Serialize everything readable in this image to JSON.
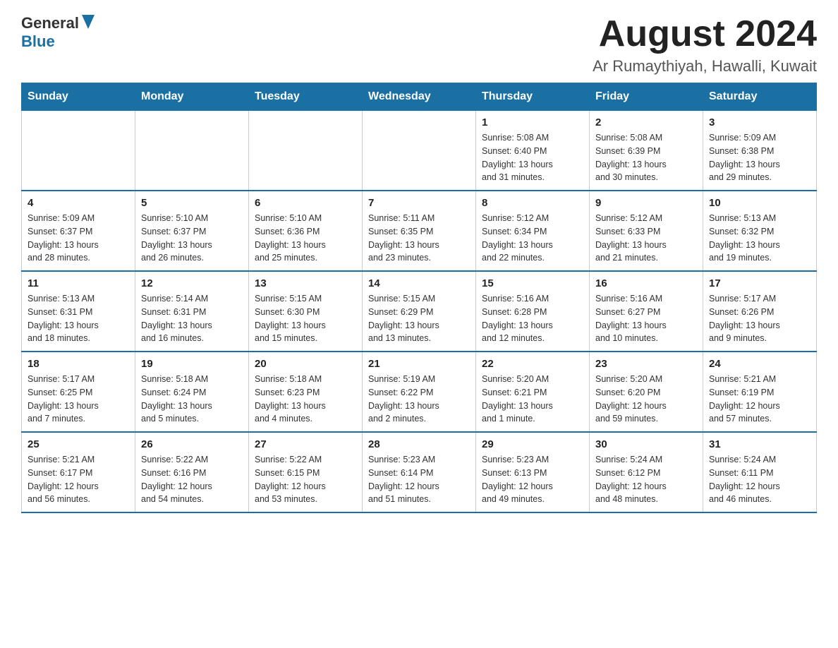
{
  "header": {
    "logo_general": "General",
    "logo_blue": "Blue",
    "month": "August 2024",
    "location": "Ar Rumaythiyah, Hawalli, Kuwait"
  },
  "weekdays": [
    "Sunday",
    "Monday",
    "Tuesday",
    "Wednesday",
    "Thursday",
    "Friday",
    "Saturday"
  ],
  "weeks": [
    [
      {
        "day": "",
        "details": ""
      },
      {
        "day": "",
        "details": ""
      },
      {
        "day": "",
        "details": ""
      },
      {
        "day": "",
        "details": ""
      },
      {
        "day": "1",
        "details": "Sunrise: 5:08 AM\nSunset: 6:40 PM\nDaylight: 13 hours\nand 31 minutes."
      },
      {
        "day": "2",
        "details": "Sunrise: 5:08 AM\nSunset: 6:39 PM\nDaylight: 13 hours\nand 30 minutes."
      },
      {
        "day": "3",
        "details": "Sunrise: 5:09 AM\nSunset: 6:38 PM\nDaylight: 13 hours\nand 29 minutes."
      }
    ],
    [
      {
        "day": "4",
        "details": "Sunrise: 5:09 AM\nSunset: 6:37 PM\nDaylight: 13 hours\nand 28 minutes."
      },
      {
        "day": "5",
        "details": "Sunrise: 5:10 AM\nSunset: 6:37 PM\nDaylight: 13 hours\nand 26 minutes."
      },
      {
        "day": "6",
        "details": "Sunrise: 5:10 AM\nSunset: 6:36 PM\nDaylight: 13 hours\nand 25 minutes."
      },
      {
        "day": "7",
        "details": "Sunrise: 5:11 AM\nSunset: 6:35 PM\nDaylight: 13 hours\nand 23 minutes."
      },
      {
        "day": "8",
        "details": "Sunrise: 5:12 AM\nSunset: 6:34 PM\nDaylight: 13 hours\nand 22 minutes."
      },
      {
        "day": "9",
        "details": "Sunrise: 5:12 AM\nSunset: 6:33 PM\nDaylight: 13 hours\nand 21 minutes."
      },
      {
        "day": "10",
        "details": "Sunrise: 5:13 AM\nSunset: 6:32 PM\nDaylight: 13 hours\nand 19 minutes."
      }
    ],
    [
      {
        "day": "11",
        "details": "Sunrise: 5:13 AM\nSunset: 6:31 PM\nDaylight: 13 hours\nand 18 minutes."
      },
      {
        "day": "12",
        "details": "Sunrise: 5:14 AM\nSunset: 6:31 PM\nDaylight: 13 hours\nand 16 minutes."
      },
      {
        "day": "13",
        "details": "Sunrise: 5:15 AM\nSunset: 6:30 PM\nDaylight: 13 hours\nand 15 minutes."
      },
      {
        "day": "14",
        "details": "Sunrise: 5:15 AM\nSunset: 6:29 PM\nDaylight: 13 hours\nand 13 minutes."
      },
      {
        "day": "15",
        "details": "Sunrise: 5:16 AM\nSunset: 6:28 PM\nDaylight: 13 hours\nand 12 minutes."
      },
      {
        "day": "16",
        "details": "Sunrise: 5:16 AM\nSunset: 6:27 PM\nDaylight: 13 hours\nand 10 minutes."
      },
      {
        "day": "17",
        "details": "Sunrise: 5:17 AM\nSunset: 6:26 PM\nDaylight: 13 hours\nand 9 minutes."
      }
    ],
    [
      {
        "day": "18",
        "details": "Sunrise: 5:17 AM\nSunset: 6:25 PM\nDaylight: 13 hours\nand 7 minutes."
      },
      {
        "day": "19",
        "details": "Sunrise: 5:18 AM\nSunset: 6:24 PM\nDaylight: 13 hours\nand 5 minutes."
      },
      {
        "day": "20",
        "details": "Sunrise: 5:18 AM\nSunset: 6:23 PM\nDaylight: 13 hours\nand 4 minutes."
      },
      {
        "day": "21",
        "details": "Sunrise: 5:19 AM\nSunset: 6:22 PM\nDaylight: 13 hours\nand 2 minutes."
      },
      {
        "day": "22",
        "details": "Sunrise: 5:20 AM\nSunset: 6:21 PM\nDaylight: 13 hours\nand 1 minute."
      },
      {
        "day": "23",
        "details": "Sunrise: 5:20 AM\nSunset: 6:20 PM\nDaylight: 12 hours\nand 59 minutes."
      },
      {
        "day": "24",
        "details": "Sunrise: 5:21 AM\nSunset: 6:19 PM\nDaylight: 12 hours\nand 57 minutes."
      }
    ],
    [
      {
        "day": "25",
        "details": "Sunrise: 5:21 AM\nSunset: 6:17 PM\nDaylight: 12 hours\nand 56 minutes."
      },
      {
        "day": "26",
        "details": "Sunrise: 5:22 AM\nSunset: 6:16 PM\nDaylight: 12 hours\nand 54 minutes."
      },
      {
        "day": "27",
        "details": "Sunrise: 5:22 AM\nSunset: 6:15 PM\nDaylight: 12 hours\nand 53 minutes."
      },
      {
        "day": "28",
        "details": "Sunrise: 5:23 AM\nSunset: 6:14 PM\nDaylight: 12 hours\nand 51 minutes."
      },
      {
        "day": "29",
        "details": "Sunrise: 5:23 AM\nSunset: 6:13 PM\nDaylight: 12 hours\nand 49 minutes."
      },
      {
        "day": "30",
        "details": "Sunrise: 5:24 AM\nSunset: 6:12 PM\nDaylight: 12 hours\nand 48 minutes."
      },
      {
        "day": "31",
        "details": "Sunrise: 5:24 AM\nSunset: 6:11 PM\nDaylight: 12 hours\nand 46 minutes."
      }
    ]
  ]
}
